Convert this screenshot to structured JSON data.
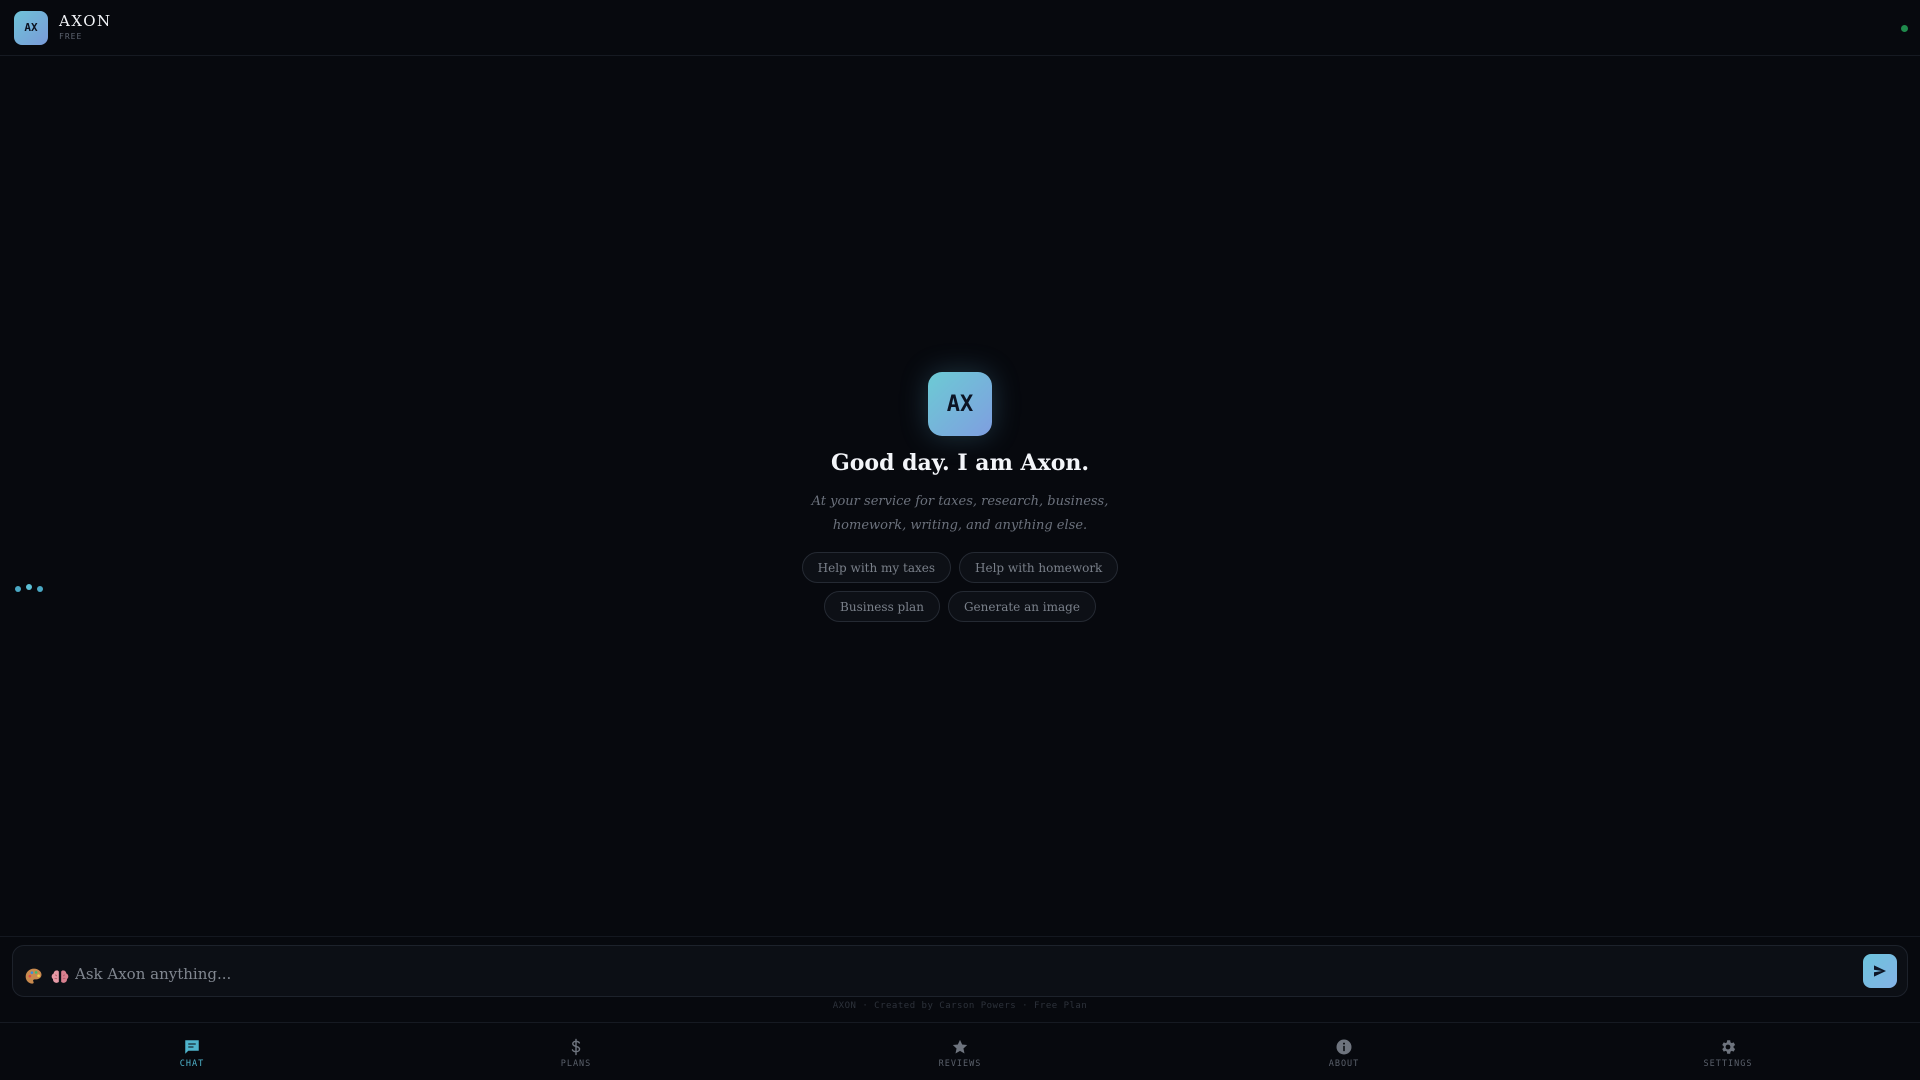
{
  "header": {
    "logo_text": "AX",
    "brand_name": "AXON",
    "plan_label": "FREE"
  },
  "hero": {
    "logo_text": "AX",
    "title": "Good day. I am Axon.",
    "subtitle": "At your service for taxes, research, business, homework, writing, and anything else.",
    "suggestions": [
      "Help with my taxes",
      "Help with homework",
      "Business plan",
      "Generate an image"
    ]
  },
  "composer": {
    "placeholder": "Ask Axon anything...",
    "value": "",
    "tool_icons": [
      "palette-icon",
      "brain-icon"
    ]
  },
  "footer": {
    "note": "AXON · Created by Carson Powers · Free Plan"
  },
  "nav": {
    "items": [
      {
        "label": "CHAT",
        "icon": "chat-icon",
        "active": true
      },
      {
        "label": "PLANS",
        "icon": "dollar-icon",
        "active": false
      },
      {
        "label": "REVIEWS",
        "icon": "star-icon",
        "active": false
      },
      {
        "label": "ABOUT",
        "icon": "info-icon",
        "active": false
      },
      {
        "label": "SETTINGS",
        "icon": "gear-icon",
        "active": false
      }
    ]
  },
  "colors": {
    "background": "#07090e",
    "accent": "#4fb4cc",
    "status_online": "#1f8a4c"
  }
}
